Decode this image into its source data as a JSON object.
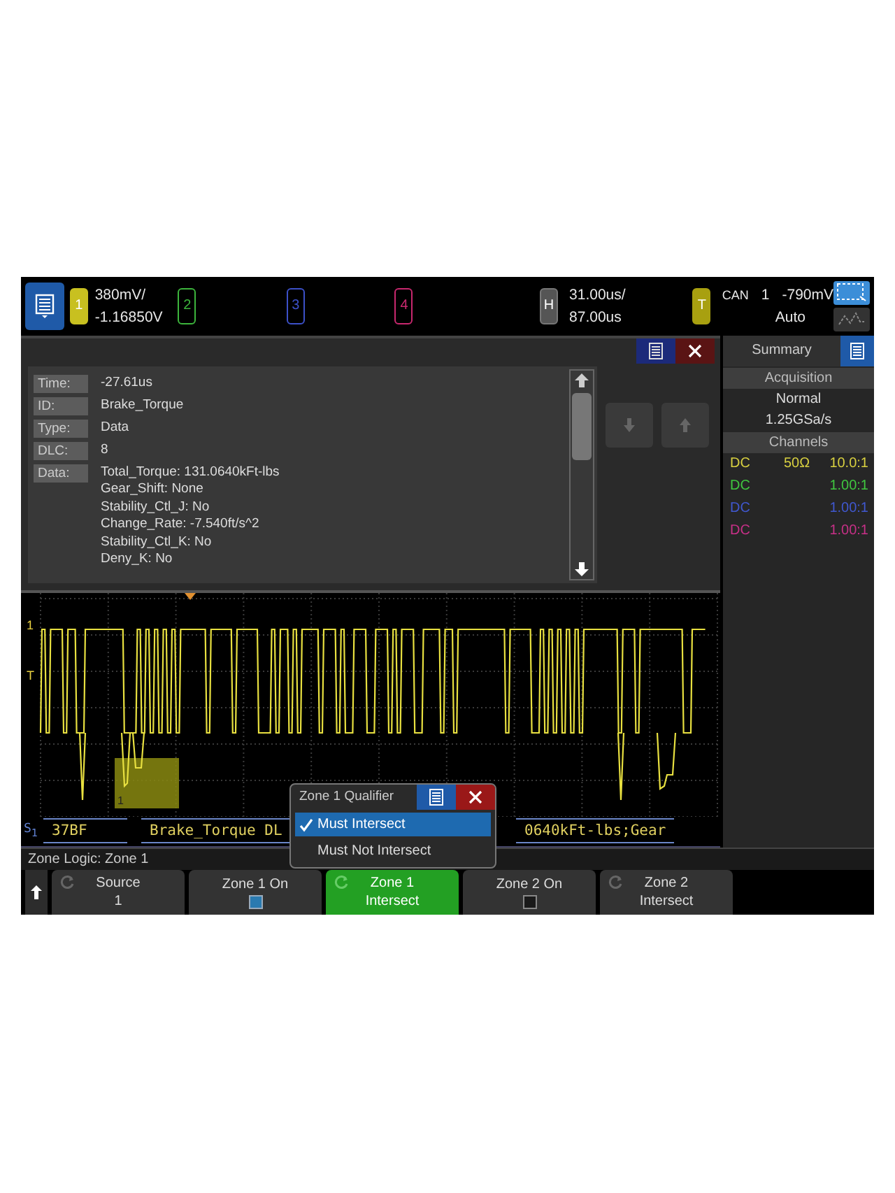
{
  "top_bar": {
    "channels": [
      {
        "label": "1",
        "on": true,
        "color": "#c8c020",
        "scale": "380mV/",
        "offset": "-1.16850V"
      },
      {
        "label": "2",
        "on": false,
        "color": "#3cb43c"
      },
      {
        "label": "3",
        "on": false,
        "color": "#3c50c8"
      },
      {
        "label": "4",
        "on": false,
        "color": "#c8286e"
      }
    ],
    "horizontal": {
      "label": "H",
      "scale": "31.00us/",
      "delay": "87.00us"
    },
    "trigger": {
      "label": "T",
      "source_type": "CAN",
      "channel": "1",
      "level": "-790mV",
      "mode": "Auto"
    }
  },
  "decode_panel": {
    "fields": [
      {
        "label": "Time:",
        "value": "-27.61us"
      },
      {
        "label": "ID:",
        "value": "Brake_Torque"
      },
      {
        "label": "Type:",
        "value": "Data"
      },
      {
        "label": "DLC:",
        "value": "8"
      },
      {
        "label": "Data:",
        "lines": [
          "Total_Torque: 131.0640kFt-lbs",
          "Gear_Shift: None",
          "Stability_Ctl_J: No",
          "Change_Rate: -7.540ft/s^2",
          "Stability_Ctl_K: No",
          "Deny_K: No"
        ]
      }
    ]
  },
  "summary": {
    "tab": "Summary",
    "acquisition_header": "Acquisition",
    "mode": "Normal",
    "sample_rate": "1.25GSa/s",
    "channels_header": "Channels",
    "channels": [
      {
        "coupling": "DC",
        "impedance": "50Ω",
        "probe": "10.0:1",
        "color": "#d8d040"
      },
      {
        "coupling": "DC",
        "probe": "1.00:1",
        "color": "#40c840"
      },
      {
        "coupling": "DC",
        "probe": "1.00:1",
        "color": "#4058d0"
      },
      {
        "coupling": "DC",
        "probe": "1.00:1",
        "color": "#c83088"
      }
    ]
  },
  "waveform": {
    "channel_marker": "1",
    "trigger_marker": "T",
    "zone_label": "1",
    "bus": {
      "label": "S$_{1}$",
      "segments": [
        "37BF",
        "Brake_Torque  DL",
        "0640kFt-lbs;Gear"
      ]
    }
  },
  "popup": {
    "title": "Zone 1 Qualifier",
    "options": [
      {
        "label": "Must Intersect",
        "selected": true
      },
      {
        "label": "Must Not Intersect",
        "selected": false
      }
    ]
  },
  "status_line": "Zone Logic: Zone 1",
  "softkeys": [
    {
      "kind": "value",
      "label": "Source",
      "value": "1",
      "selected": false
    },
    {
      "kind": "checkbox",
      "label": "Zone 1 On",
      "checked": true,
      "selected": false
    },
    {
      "kind": "value",
      "label": "Zone 1",
      "value": "Intersect",
      "selected": true
    },
    {
      "kind": "checkbox",
      "label": "Zone 2 On",
      "checked": false,
      "selected": false
    },
    {
      "kind": "value",
      "label": "Zone 2",
      "value": "Intersect",
      "selected": false
    }
  ]
}
